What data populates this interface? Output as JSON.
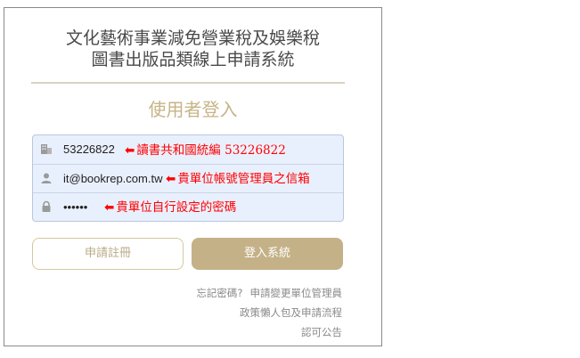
{
  "header": {
    "title_line1": "文化藝術事業減免營業稅及娛樂稅",
    "title_line2": "圖書出版品類線上申請系統"
  },
  "login": {
    "heading": "使用者登入",
    "fields": [
      {
        "icon": "building-icon",
        "value": "53226822",
        "annotation": "讀書共和國統編 53226822"
      },
      {
        "icon": "user-icon",
        "value": "it@bookrep.com.tw",
        "annotation": "貴單位帳號管理員之信箱"
      },
      {
        "icon": "lock-icon",
        "value": "••••••",
        "annotation": "貴單位自行設定的密碼"
      }
    ],
    "annotation_arrow": "⬅",
    "annotation_color": "#ff0000"
  },
  "buttons": {
    "register_label": "申請註冊",
    "login_label": "登入系統"
  },
  "links": {
    "forgot_password": "忘記密碼?",
    "change_admin": "申請變更單位管理員",
    "policy_guide": "政策懶人包及申請流程",
    "approval_notice": "認可公告"
  },
  "colors": {
    "accent_gold": "#c4b187",
    "field_bg": "#e9f0fd"
  }
}
